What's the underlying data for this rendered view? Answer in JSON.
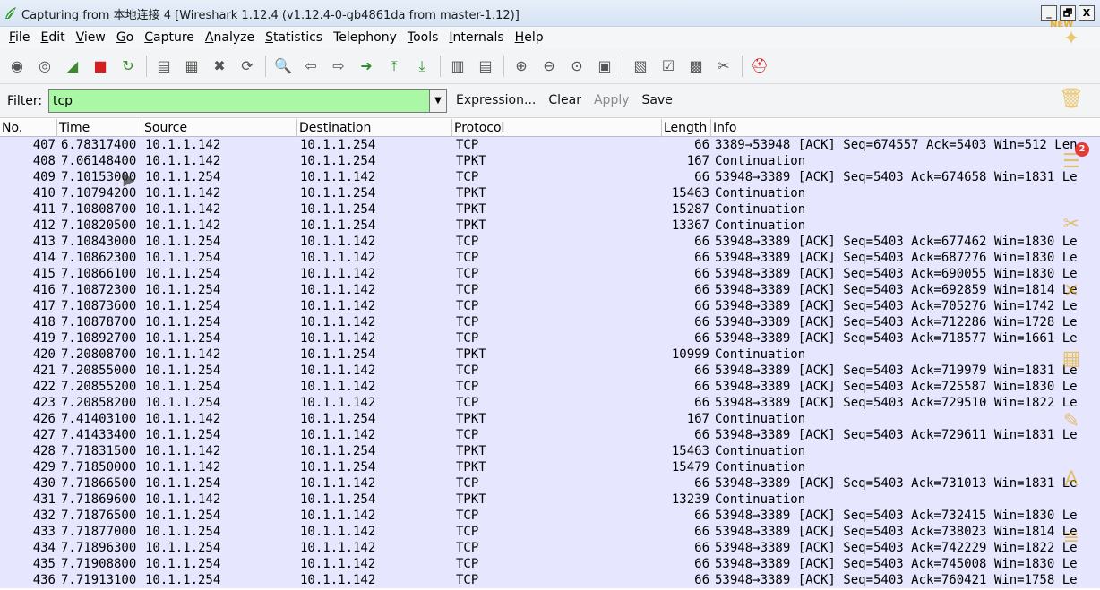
{
  "window": {
    "title": "Capturing from 本地连接 4   [Wireshark 1.12.4  (v1.12.4-0-gb4861da from master-1.12)]",
    "controls": [
      "_",
      "🗗",
      "X"
    ]
  },
  "menu": {
    "items": [
      {
        "ul": "F",
        "rest": "ile"
      },
      {
        "ul": "E",
        "rest": "dit"
      },
      {
        "ul": "V",
        "rest": "iew"
      },
      {
        "ul": "G",
        "rest": "o"
      },
      {
        "ul": "C",
        "rest": "apture"
      },
      {
        "ul": "A",
        "rest": "nalyze"
      },
      {
        "ul": "S",
        "rest": "tatistics"
      },
      {
        "ul": "",
        "rest": "Telephony"
      },
      {
        "ul": "T",
        "rest": "ools"
      },
      {
        "ul": "I",
        "rest": "nternals"
      },
      {
        "ul": "H",
        "rest": "elp"
      }
    ]
  },
  "toolbar": {
    "icons": [
      "interface-list-icon",
      "capture-options-icon",
      "start-capture-icon",
      "stop-capture-icon",
      "restart-capture-icon",
      "SEP",
      "open-file-icon",
      "save-file-icon",
      "close-file-icon",
      "reload-icon",
      "SEP",
      "find-packet-icon",
      "go-back-icon",
      "go-forward-icon",
      "go-to-packet-icon",
      "go-first-icon",
      "go-last-icon",
      "SEP",
      "colorize-icon",
      "auto-scroll-icon",
      "SEP",
      "zoom-in-icon",
      "zoom-out-icon",
      "zoom-normal-icon",
      "resize-columns-icon",
      "SEP",
      "capture-filters-icon",
      "display-filters-icon",
      "coloring-rules-icon",
      "preferences-icon",
      "SEP",
      "help-icon"
    ],
    "glyphs": {
      "interface-list-icon": "◉",
      "capture-options-icon": "◎",
      "start-capture-icon": "◢",
      "stop-capture-icon": "■",
      "restart-capture-icon": "↻",
      "open-file-icon": "▤",
      "save-file-icon": "▦",
      "close-file-icon": "✖",
      "reload-icon": "⟳",
      "find-packet-icon": "🔍",
      "go-back-icon": "⇦",
      "go-forward-icon": "⇨",
      "go-to-packet-icon": "➜",
      "go-first-icon": "⤒",
      "go-last-icon": "⤓",
      "colorize-icon": "▥",
      "auto-scroll-icon": "▤",
      "zoom-in-icon": "⊕",
      "zoom-out-icon": "⊖",
      "zoom-normal-icon": "⊙",
      "resize-columns-icon": "▣",
      "capture-filters-icon": "▧",
      "display-filters-icon": "☑",
      "coloring-rules-icon": "▩",
      "preferences-icon": "✂",
      "help-icon": "⛑"
    },
    "colors": {
      "start-capture-icon": "#3b8a2e",
      "stop-capture-icon": "#d21f1f",
      "restart-capture-icon": "#3b8a2e",
      "go-to-packet-icon": "#2f8f2f",
      "go-first-icon": "#2f8f2f",
      "go-last-icon": "#2f8f2f",
      "help-icon": "#d02020"
    }
  },
  "filter": {
    "label": "Filter:",
    "value": "tcp",
    "dropdown_glyph": "▼",
    "actions": [
      {
        "name": "expression-button",
        "label": "Expression...",
        "enabled": true
      },
      {
        "name": "clear-button",
        "label": "Clear",
        "enabled": true
      },
      {
        "name": "apply-button",
        "label": "Apply",
        "enabled": false
      },
      {
        "name": "save-button",
        "label": "Save",
        "enabled": true
      }
    ]
  },
  "packet_list": {
    "columns": [
      "No.",
      "Time",
      "Source",
      "Destination",
      "Protocol",
      "Length",
      "Info"
    ],
    "rows": [
      [
        "407",
        "6.78317400",
        "10.1.1.142",
        "10.1.1.254",
        "TCP",
        "66",
        "3389→53948 [ACK] Seq=674557 Ack=5403 Win=512 Len"
      ],
      [
        "408",
        "7.06148400",
        "10.1.1.142",
        "10.1.1.254",
        "TPKT",
        "167",
        "Continuation"
      ],
      [
        "409",
        "7.10153000",
        "10.1.1.254",
        "10.1.1.142",
        "TCP",
        "66",
        "53948→3389 [ACK] Seq=5403 Ack=674658 Win=1831 Le"
      ],
      [
        "410",
        "7.10794200",
        "10.1.1.142",
        "10.1.1.254",
        "TPKT",
        "15463",
        "Continuation"
      ],
      [
        "411",
        "7.10808700",
        "10.1.1.142",
        "10.1.1.254",
        "TPKT",
        "15287",
        "Continuation"
      ],
      [
        "412",
        "7.10820500",
        "10.1.1.142",
        "10.1.1.254",
        "TPKT",
        "13367",
        "Continuation"
      ],
      [
        "413",
        "7.10843000",
        "10.1.1.254",
        "10.1.1.142",
        "TCP",
        "66",
        "53948→3389 [ACK] Seq=5403 Ack=677462 Win=1830 Le"
      ],
      [
        "414",
        "7.10862300",
        "10.1.1.254",
        "10.1.1.142",
        "TCP",
        "66",
        "53948→3389 [ACK] Seq=5403 Ack=687276 Win=1830 Le"
      ],
      [
        "415",
        "7.10866100",
        "10.1.1.254",
        "10.1.1.142",
        "TCP",
        "66",
        "53948→3389 [ACK] Seq=5403 Ack=690055 Win=1830 Le"
      ],
      [
        "416",
        "7.10872300",
        "10.1.1.254",
        "10.1.1.142",
        "TCP",
        "66",
        "53948→3389 [ACK] Seq=5403 Ack=692859 Win=1814 Le"
      ],
      [
        "417",
        "7.10873600",
        "10.1.1.254",
        "10.1.1.142",
        "TCP",
        "66",
        "53948→3389 [ACK] Seq=5403 Ack=705276 Win=1742 Le"
      ],
      [
        "418",
        "7.10878700",
        "10.1.1.254",
        "10.1.1.142",
        "TCP",
        "66",
        "53948→3389 [ACK] Seq=5403 Ack=712286 Win=1728 Le"
      ],
      [
        "419",
        "7.10892700",
        "10.1.1.254",
        "10.1.1.142",
        "TCP",
        "66",
        "53948→3389 [ACK] Seq=5403 Ack=718577 Win=1661 Le"
      ],
      [
        "420",
        "7.20808700",
        "10.1.1.142",
        "10.1.1.254",
        "TPKT",
        "10999",
        "Continuation"
      ],
      [
        "421",
        "7.20855000",
        "10.1.1.254",
        "10.1.1.142",
        "TCP",
        "66",
        "53948→3389 [ACK] Seq=5403 Ack=719979 Win=1831 Le"
      ],
      [
        "422",
        "7.20855200",
        "10.1.1.254",
        "10.1.1.142",
        "TCP",
        "66",
        "53948→3389 [ACK] Seq=5403 Ack=725587 Win=1830 Le"
      ],
      [
        "423",
        "7.20858200",
        "10.1.1.254",
        "10.1.1.142",
        "TCP",
        "66",
        "53948→3389 [ACK] Seq=5403 Ack=729510 Win=1822 Le"
      ],
      [
        "426",
        "7.41403100",
        "10.1.1.142",
        "10.1.1.254",
        "TPKT",
        "167",
        "Continuation"
      ],
      [
        "427",
        "7.41433400",
        "10.1.1.254",
        "10.1.1.142",
        "TCP",
        "66",
        "53948→3389 [ACK] Seq=5403 Ack=729611 Win=1831 Le"
      ],
      [
        "428",
        "7.71831500",
        "10.1.1.142",
        "10.1.1.254",
        "TPKT",
        "15463",
        "Continuation"
      ],
      [
        "429",
        "7.71850000",
        "10.1.1.142",
        "10.1.1.254",
        "TPKT",
        "15479",
        "Continuation"
      ],
      [
        "430",
        "7.71866500",
        "10.1.1.254",
        "10.1.1.142",
        "TCP",
        "66",
        "53948→3389 [ACK] Seq=5403 Ack=731013 Win=1831 Le"
      ],
      [
        "431",
        "7.71869600",
        "10.1.1.142",
        "10.1.1.254",
        "TPKT",
        "13239",
        "Continuation"
      ],
      [
        "432",
        "7.71876500",
        "10.1.1.254",
        "10.1.1.142",
        "TCP",
        "66",
        "53948→3389 [ACK] Seq=5403 Ack=732415 Win=1830 Le"
      ],
      [
        "433",
        "7.71877000",
        "10.1.1.254",
        "10.1.1.142",
        "TCP",
        "66",
        "53948→3389 [ACK] Seq=5403 Ack=738023 Win=1814 Le"
      ],
      [
        "434",
        "7.71896300",
        "10.1.1.254",
        "10.1.1.142",
        "TCP",
        "66",
        "53948→3389 [ACK] Seq=5403 Ack=742229 Win=1822 Le"
      ],
      [
        "435",
        "7.71908800",
        "10.1.1.254",
        "10.1.1.142",
        "TCP",
        "66",
        "53948→3389 [ACK] Seq=5403 Ack=745008 Win=1830 Le"
      ],
      [
        "436",
        "7.71913100",
        "10.1.1.254",
        "10.1.1.142",
        "TCP",
        "66",
        "53948→3389 [ACK] Seq=5403 Ack=760421 Win=1758 Le"
      ]
    ],
    "row_color": "#e7e6ff"
  },
  "overlay": {
    "new_tag": "NEW",
    "badge_count": "2",
    "icons": [
      "refresh-icon",
      "trash-icon",
      "switch-icon",
      "cut-icon",
      "tools-icon",
      "book-icon",
      "note-icon",
      "translate-icon",
      "more-icon"
    ],
    "glyphs": [
      "✦",
      "🗑",
      "☰",
      "✂",
      "✕",
      "▦",
      "✎",
      "A",
      "≡"
    ]
  },
  "colors": {
    "filter_bg": "#aaf7a5",
    "titlebar": "#dce7f5"
  }
}
